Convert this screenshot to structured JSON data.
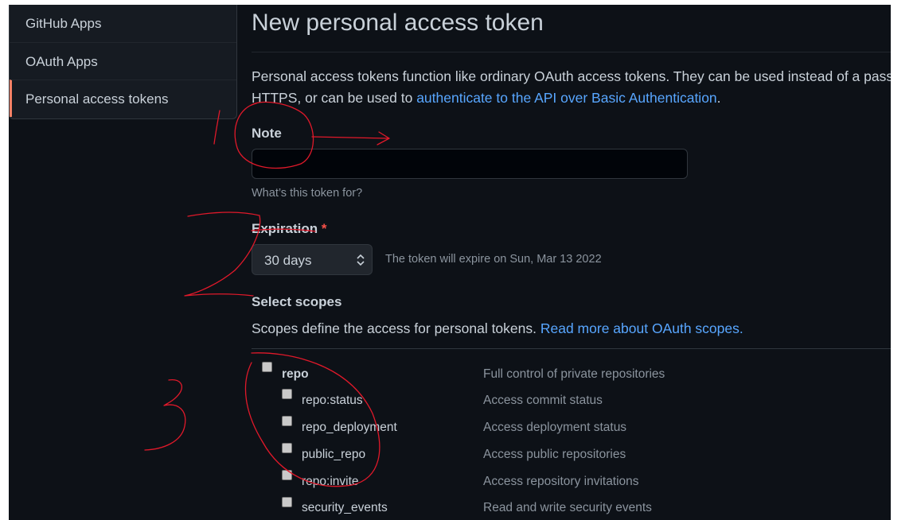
{
  "sidebar": {
    "items": [
      {
        "label": "GitHub Apps"
      },
      {
        "label": "OAuth Apps"
      },
      {
        "label": "Personal access tokens"
      }
    ]
  },
  "page": {
    "title": "New personal access token",
    "intro_prefix": "Personal access tokens function like ordinary OAuth access tokens. They can be used instead of a passwo",
    "intro_line2_prefix": "HTTPS, or can be used to ",
    "intro_link": "authenticate to the API over Basic Authentication",
    "intro_suffix": "."
  },
  "note": {
    "label": "Note",
    "value": "",
    "hint": "What’s this token for?"
  },
  "expiration": {
    "label": "Expiration",
    "required_marker": "*",
    "selected": "30 days",
    "expiry_text": "The token will expire on Sun, Mar 13 2022"
  },
  "scopes": {
    "label": "Select scopes",
    "description": "Scopes define the access for personal tokens. ",
    "link": "Read more about OAuth scopes.",
    "items": [
      {
        "name": "repo",
        "description": "Full control of private repositories",
        "checked": false
      },
      {
        "name": "repo:status",
        "description": "Access commit status",
        "checked": false
      },
      {
        "name": "repo_deployment",
        "description": "Access deployment status",
        "checked": false
      },
      {
        "name": "public_repo",
        "description": "Access public repositories",
        "checked": false
      },
      {
        "name": "repo:invite",
        "description": "Access repository invitations",
        "checked": false
      },
      {
        "name": "security_events",
        "description": "Read and write security events",
        "checked": false
      }
    ]
  },
  "annotations": {
    "marker_1": "1",
    "marker_2": "2",
    "marker_3": "3",
    "color": "#e0192a"
  },
  "colors": {
    "accent_link": "#58a6ff",
    "required": "#f85149",
    "active_tab": "#f78166",
    "background": "#0d1117"
  }
}
